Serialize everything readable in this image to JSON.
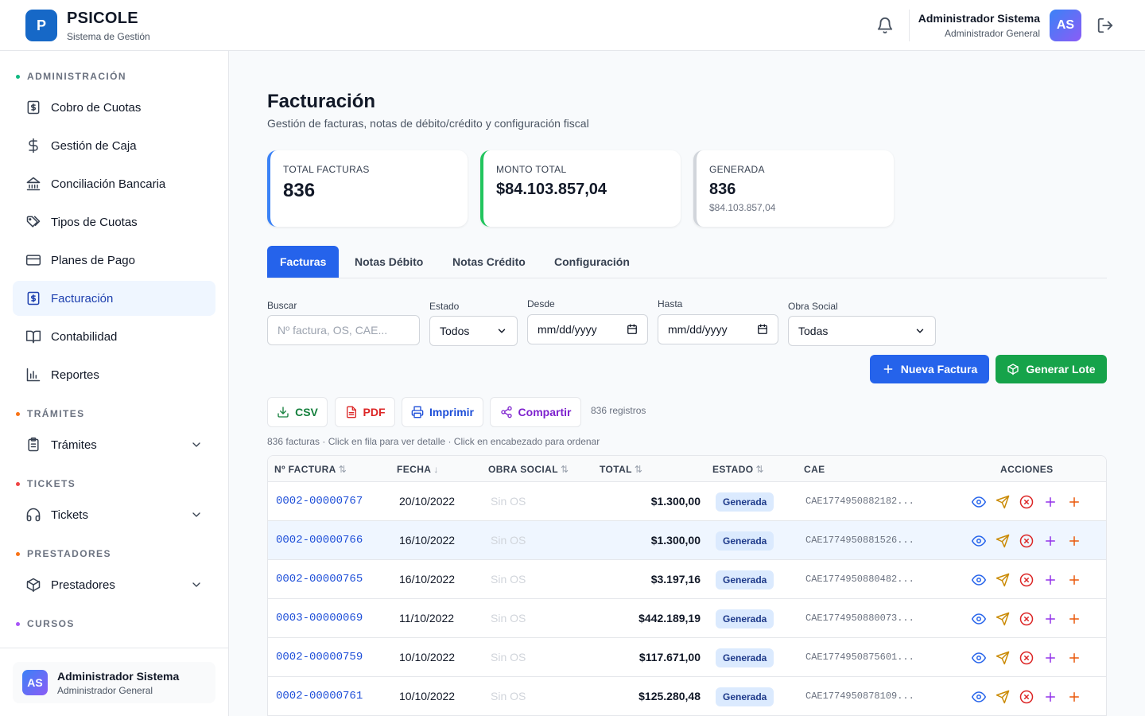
{
  "app": {
    "logo_letter": "P",
    "name": "PSICOLE",
    "subtitle": "Sistema de Gestión"
  },
  "header": {
    "user_name": "Administrador Sistema",
    "user_role": "Administrador General",
    "avatar_initials": "AS"
  },
  "sidebar": {
    "sections": {
      "administracion": "ADMINISTRACIÓN",
      "tramites": "TRÁMITES",
      "tickets": "TICKETS",
      "prestadores": "PRESTADORES",
      "cursos": "CURSOS"
    },
    "items": [
      {
        "label": "Cobro de Cuotas",
        "icon": "receipt-dollar-icon"
      },
      {
        "label": "Gestión de Caja",
        "icon": "dollar-icon"
      },
      {
        "label": "Conciliación Bancaria",
        "icon": "bank-icon"
      },
      {
        "label": "Tipos de Cuotas",
        "icon": "tags-icon"
      },
      {
        "label": "Planes de Pago",
        "icon": "credit-card-icon"
      },
      {
        "label": "Facturación",
        "icon": "receipt-dollar-icon",
        "active": true
      },
      {
        "label": "Contabilidad",
        "icon": "book-icon"
      },
      {
        "label": "Reportes",
        "icon": "bar-chart-icon"
      },
      {
        "label": "Trámites",
        "icon": "clipboard-icon"
      },
      {
        "label": "Tickets",
        "icon": "headphones-icon"
      },
      {
        "label": "Prestadores",
        "icon": "box-icon"
      }
    ],
    "user_card": {
      "initials": "AS",
      "name": "Administrador Sistema",
      "role": "Administrador General"
    }
  },
  "page": {
    "title": "Facturación",
    "subtitle": "Gestión de facturas, notas de débito/crédito y configuración fiscal"
  },
  "stats": [
    {
      "label": "TOTAL FACTURAS",
      "value": "836",
      "color": "#3b82f6"
    },
    {
      "label": "MONTO TOTAL",
      "value": "$84.103.857,04",
      "color": "#22c55e"
    },
    {
      "label": "GENERADA",
      "value": "836",
      "sub": "$84.103.857,04",
      "color": "#d1d5db"
    }
  ],
  "tabs": [
    "Facturas",
    "Notas Débito",
    "Notas Crédito",
    "Configuración"
  ],
  "filters": {
    "buscar_label": "Buscar",
    "buscar_placeholder": "Nº factura, OS, CAE...",
    "estado_label": "Estado",
    "estado_value": "Todos",
    "desde_label": "Desde",
    "desde_value": "mm/dd/yyyy",
    "hasta_label": "Hasta",
    "hasta_value": "mm/dd/yyyy",
    "obra_label": "Obra Social",
    "obra_value": "Todas"
  },
  "buttons": {
    "nueva": "Nueva Factura",
    "lote": "Generar Lote",
    "csv": "CSV",
    "pdf": "PDF",
    "imprimir": "Imprimir",
    "compartir": "Compartir"
  },
  "registros": "836 registros",
  "hint": "836 facturas · Click en fila para ver detalle · Click en encabezado para ordenar",
  "table": {
    "headers": [
      "Nº FACTURA",
      "FECHA",
      "OBRA SOCIAL",
      "TOTAL",
      "ESTADO",
      "CAE",
      "ACCIONES"
    ],
    "sort_glyphs": {
      "factura": "⇅",
      "fecha": "↓",
      "obra": "⇅",
      "total": "⇅",
      "estado": "⇅"
    },
    "rows": [
      {
        "numero": "0002-00000767",
        "fecha": "20/10/2022",
        "obra_social": "Sin OS",
        "total": "$1.300,00",
        "estado": "Generada",
        "cae": "CAE1774950882182..."
      },
      {
        "numero": "0002-00000766",
        "fecha": "16/10/2022",
        "obra_social": "Sin OS",
        "total": "$1.300,00",
        "estado": "Generada",
        "cae": "CAE1774950881526..."
      },
      {
        "numero": "0002-00000765",
        "fecha": "16/10/2022",
        "obra_social": "Sin OS",
        "total": "$3.197,16",
        "estado": "Generada",
        "cae": "CAE1774950880482..."
      },
      {
        "numero": "0003-00000069",
        "fecha": "11/10/2022",
        "obra_social": "Sin OS",
        "total": "$442.189,19",
        "estado": "Generada",
        "cae": "CAE1774950880073..."
      },
      {
        "numero": "0002-00000759",
        "fecha": "10/10/2022",
        "obra_social": "Sin OS",
        "total": "$117.671,00",
        "estado": "Generada",
        "cae": "CAE1774950875601..."
      },
      {
        "numero": "0002-00000761",
        "fecha": "10/10/2022",
        "obra_social": "Sin OS",
        "total": "$125.280,48",
        "estado": "Generada",
        "cae": "CAE1774950878109..."
      }
    ]
  },
  "colors": {
    "primary": "#2563eb",
    "success": "#16a34a",
    "brand": "#1668c7"
  }
}
